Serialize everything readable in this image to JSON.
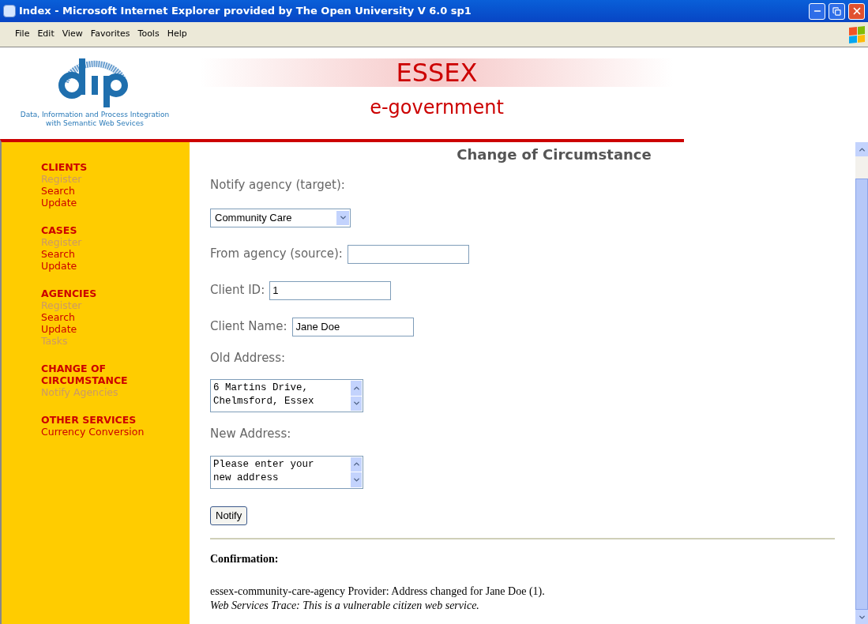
{
  "window": {
    "title": "Index - Microsoft Internet Explorer provided by The Open University V 6.0 sp1"
  },
  "menu": [
    "File",
    "Edit",
    "View",
    "Favorites",
    "Tools",
    "Help"
  ],
  "header": {
    "logo_caption": "Data, Information and Process Integration\nwith Semantic Web Sevices",
    "title": "ESSEX",
    "subtitle": "e-government"
  },
  "sidebar": [
    {
      "heading": "CLIENTS",
      "items": [
        {
          "label": "Register",
          "disabled": true
        },
        {
          "label": "Search",
          "disabled": false
        },
        {
          "label": "Update",
          "disabled": false
        }
      ]
    },
    {
      "heading": "CASES",
      "items": [
        {
          "label": "Register",
          "disabled": true
        },
        {
          "label": "Search",
          "disabled": false
        },
        {
          "label": "Update",
          "disabled": false
        }
      ]
    },
    {
      "heading": "AGENCIES",
      "items": [
        {
          "label": "Register",
          "disabled": true
        },
        {
          "label": "Search",
          "disabled": false
        },
        {
          "label": "Update",
          "disabled": false
        },
        {
          "label": "Tasks",
          "disabled": true
        }
      ]
    },
    {
      "heading": "CHANGE OF CIRCUMSTANCE",
      "items": [
        {
          "label": "Notify Agencies",
          "disabled": true
        }
      ]
    },
    {
      "heading": "OTHER SERVICES",
      "items": [
        {
          "label": "Currency Conversion",
          "disabled": false
        }
      ]
    }
  ],
  "form": {
    "title": "Change of Circumstance",
    "notify_label": "Notify agency (target):",
    "notify_value": "Community Care",
    "from_label": "From agency (source):",
    "client_id_label": "Client ID:",
    "client_id_value": "1",
    "client_name_label": "Client Name:",
    "client_name_value": "Jane Doe",
    "old_address_label": "Old Address:",
    "old_address_value": "6 Martins Drive,\nChelmsford, Essex",
    "new_address_label": "New Address:",
    "new_address_value": "Please enter your\nnew address",
    "button": "Notify"
  },
  "confirmation": {
    "heading": "Confirmation:",
    "message": "essex-community-care-agency Provider: Address changed for Jane Doe (1).",
    "trace": "Web Services Trace: This is a vulnerable citizen web service."
  }
}
